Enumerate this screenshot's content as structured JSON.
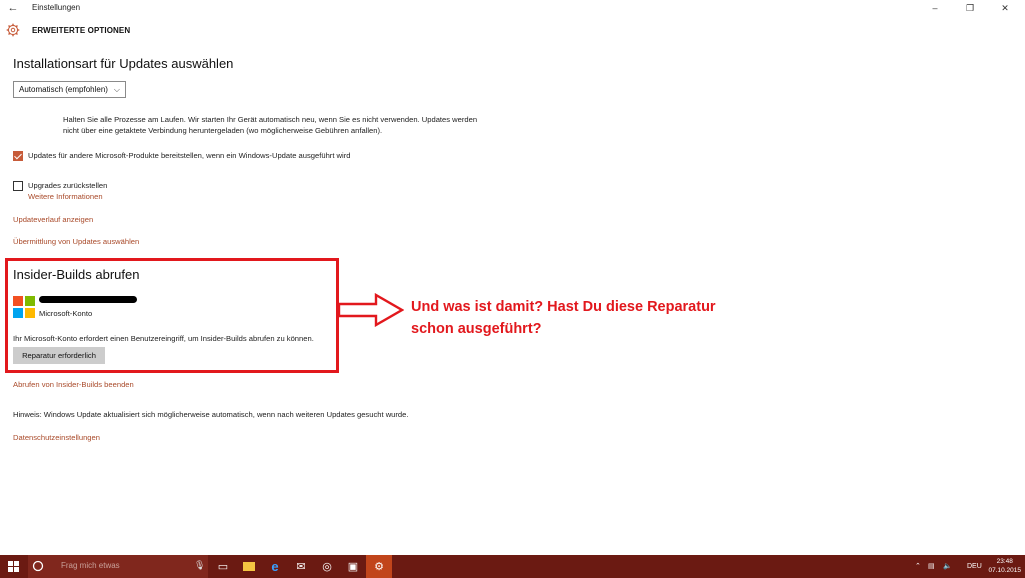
{
  "window": {
    "title": "Einstellungen",
    "minimize": "–",
    "restore": "❐",
    "close": "✕"
  },
  "header": {
    "title": "ERWEITERTE OPTIONEN"
  },
  "install_section": {
    "heading": "Installationsart für Updates auswählen",
    "dropdown_value": "Automatisch (empfohlen)",
    "description_line1": "Halten Sie alle Prozesse am Laufen. Wir starten Ihr Gerät automatisch neu, wenn Sie es nicht verwenden. Updates werden",
    "description_line2": "nicht über eine getaktete Verbindung heruntergeladen (wo möglicherweise Gebühren anfallen)."
  },
  "options": {
    "ms_products_label": "Updates für andere Microsoft-Produkte bereitstellen, wenn ein Windows-Update ausgeführt wird",
    "ms_products_checked": true,
    "defer_label": "Upgrades zurückstellen",
    "defer_checked": false,
    "more_info_link": "Weitere Informationen"
  },
  "links": {
    "history": "Updateverlauf anzeigen",
    "delivery": "Übermittlung von Updates auswählen",
    "stop_insider": "Abrufen von Insider-Builds beenden",
    "privacy": "Datenschutzeinstellungen"
  },
  "insider": {
    "heading": "Insider-Builds abrufen",
    "account_label": "Microsoft-Konto",
    "message": "Ihr Microsoft-Konto erfordert einen Benutzereingriff, um Insider-Builds abrufen zu können.",
    "repair_button": "Reparatur erforderlich"
  },
  "hint": "Hinweis: Windows Update aktualisiert sich möglicherweise automatisch, wenn nach weiteren Updates gesucht wurde.",
  "annotation": {
    "line1": "Und was ist damit? Hast Du diese Reparatur",
    "line2": "schon ausgeführt?"
  },
  "taskbar": {
    "search_placeholder": "Frag mich etwas",
    "language": "DEU",
    "time": "23:48",
    "date": "07.10.2015"
  },
  "colors": {
    "accent": "#c75b39",
    "link": "#a94a2a",
    "annotation_red": "#e2181d",
    "taskbar": "#6b1a12"
  }
}
